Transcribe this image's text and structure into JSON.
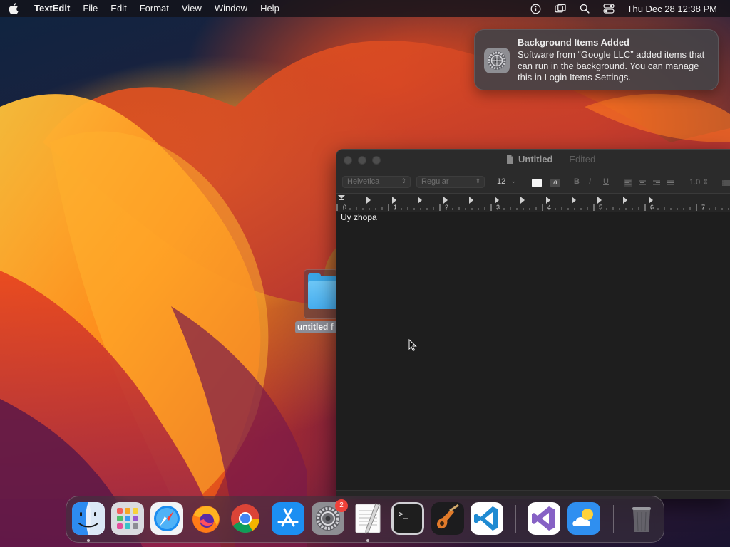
{
  "menubar": {
    "apple_icon": "apple-icon",
    "app_name": "TextEdit",
    "items": [
      "File",
      "Edit",
      "Format",
      "View",
      "Window",
      "Help"
    ],
    "status_icons": [
      "info-icon",
      "screen-mirroring-icon",
      "search-icon",
      "control-center-icon"
    ],
    "clock": "Thu Dec 28  12:38 PM"
  },
  "notification": {
    "icon": "system-settings-icon",
    "title": "Background Items Added",
    "body": "Software from “Google LLC” added items that can run in the background. You can manage this in Login Items Settings."
  },
  "desktop": {
    "folder_label": "untitled f"
  },
  "window": {
    "title": "Untitled",
    "separator": "—",
    "status": "Edited",
    "toolbar": {
      "font_family": "Helvetica",
      "font_style": "Regular",
      "font_size": "12",
      "bold": "B",
      "italic": "I",
      "underline": "U",
      "line_spacing": "1.0",
      "highlight_label": "a"
    },
    "ruler_labels": [
      "0",
      "1",
      "2",
      "3",
      "4",
      "5",
      "6",
      "7"
    ],
    "document_text": "Uy zhopa"
  },
  "dock": {
    "apps": [
      {
        "name": "Finder",
        "icon": "finder-icon",
        "running": true
      },
      {
        "name": "Launchpad",
        "icon": "launchpad-icon",
        "running": false
      },
      {
        "name": "Safari",
        "icon": "safari-icon",
        "running": false
      },
      {
        "name": "Firefox",
        "icon": "firefox-icon",
        "running": false
      },
      {
        "name": "Google Chrome",
        "icon": "chrome-icon",
        "running": false
      },
      {
        "name": "App Store",
        "icon": "app-store-icon",
        "running": false
      },
      {
        "name": "System Settings",
        "icon": "system-settings-icon",
        "running": false,
        "badge": "2"
      },
      {
        "name": "TextEdit",
        "icon": "textedit-icon",
        "running": true
      },
      {
        "name": "Terminal",
        "icon": "terminal-icon",
        "running": false
      },
      {
        "name": "GarageBand",
        "icon": "garageband-icon",
        "running": false
      },
      {
        "name": "Visual Studio Code",
        "icon": "vscode-icon",
        "running": false
      },
      {
        "name": "Visual Studio",
        "icon": "visual-studio-icon",
        "running": false
      },
      {
        "name": "Weather",
        "icon": "weather-icon",
        "running": false
      },
      {
        "name": "Trash",
        "icon": "trash-icon",
        "running": false
      }
    ],
    "settings_badge": "2",
    "terminal_prompt": ">_"
  },
  "colors": {
    "accent_badge": "#f0413a",
    "window_bg": "#1e1e1e",
    "folder_blue": "#46aef0"
  }
}
